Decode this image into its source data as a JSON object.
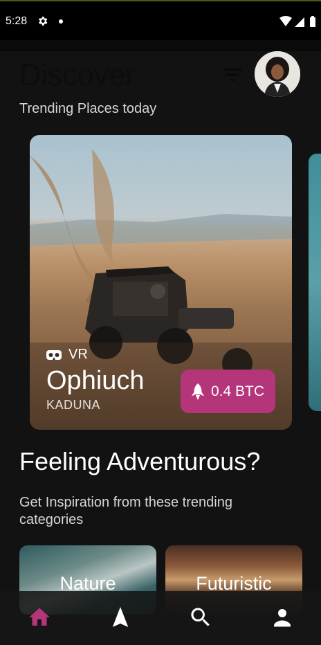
{
  "status_bar": {
    "time": "5:28",
    "icons": [
      "gear-icon",
      "notification-dot-icon",
      "wifi-icon",
      "signal-icon",
      "battery-icon"
    ]
  },
  "header": {
    "title": "Discover",
    "subtitle": "Trending Places today"
  },
  "featured": {
    "badge_label": "VR",
    "name": "Ophiuch",
    "city": "KADUNA",
    "price_label": "0.4 BTC"
  },
  "section": {
    "title": "Feeling Adventurous?",
    "subtitle": "Get Inspiration from these trending categories"
  },
  "categories": [
    {
      "label": "Nature"
    },
    {
      "label": "Futuristic"
    }
  ],
  "bottom_nav": {
    "items": [
      "home-icon",
      "explore-icon",
      "search-icon",
      "profile-icon"
    ],
    "active_color": "#b5357a",
    "inactive_color": "#ffffff"
  },
  "colors": {
    "background": "#121212",
    "accent": "#b5357a"
  }
}
